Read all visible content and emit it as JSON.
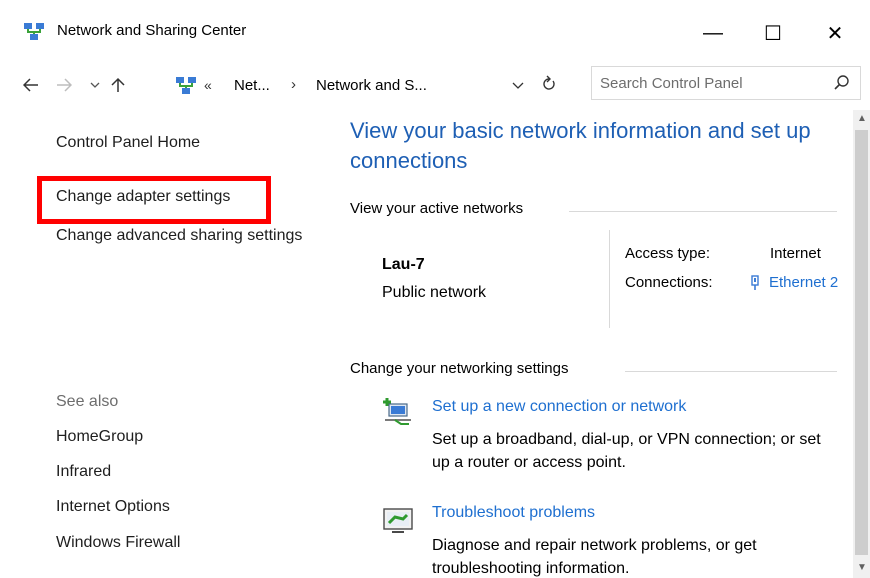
{
  "window": {
    "title": "Network and Sharing Center",
    "minimize_glyph": "—",
    "maximize_glyph": "☐",
    "close_glyph": "✕"
  },
  "addressbar": {
    "overflow": "«",
    "crumbs": [
      "Net...",
      "Network and S..."
    ],
    "separator": "›",
    "search_placeholder": "Search Control Panel"
  },
  "left_pane": {
    "control_panel_home": "Control Panel Home",
    "change_adapter": "Change adapter settings",
    "change_advanced": "Change advanced sharing settings",
    "see_also_label": "See also",
    "see_also": [
      "HomeGroup",
      "Infrared",
      "Internet Options",
      "Windows Firewall"
    ]
  },
  "main": {
    "title": "View your basic network information and set up connections",
    "active_networks_heading": "View your active networks",
    "network_name": "Lau-7",
    "network_type": "Public network",
    "access_type_label": "Access type:",
    "access_type_value": "Internet",
    "connections_label": "Connections:",
    "connection_link": "Ethernet 2",
    "change_heading": "Change your networking settings",
    "tasks": [
      {
        "link": "Set up a new connection or network",
        "description": "Set up a broadband, dial-up, or VPN connection; or set up a router or access point.",
        "icon": "new-connection-icon"
      },
      {
        "link": "Troubleshoot problems",
        "description": "Diagnose and repair network problems, or get troubleshooting information.",
        "icon": "troubleshoot-icon"
      }
    ]
  },
  "colors": {
    "title_blue": "#1e5fb4",
    "link_blue": "#1e6fd0",
    "highlight_red": "#ff0000"
  }
}
